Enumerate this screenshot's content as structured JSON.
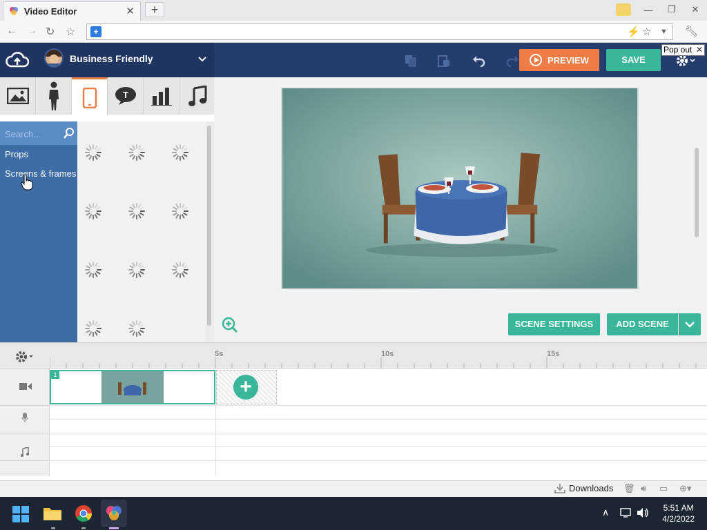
{
  "browser": {
    "tab_title": "Video Editor",
    "tab_close": "✕",
    "new_tab": "+",
    "url": ""
  },
  "header": {
    "theme_name": "Business Friendly",
    "preview_label": "PREVIEW",
    "save_label": "SAVE",
    "popout_label": "Pop out",
    "popout_close": "✕"
  },
  "library": {
    "search_placeholder": "Search...",
    "categories": [
      {
        "label": "Props"
      },
      {
        "label": "Screens & frames"
      }
    ],
    "selected_tab": "phone"
  },
  "stage": {
    "scene_settings_label": "SCENE SETTINGS",
    "add_scene_label": "ADD SCENE"
  },
  "timeline": {
    "ticks": [
      "5s",
      "10s",
      "15s"
    ],
    "scene_number": "1"
  },
  "downloads": {
    "label": "Downloads"
  },
  "taskbar": {
    "time": "5:51 AM",
    "date": "4/2/2022"
  },
  "colors": {
    "accent_orange": "#ef7b45",
    "accent_green": "#3ab79a",
    "header_navy": "#253d6c",
    "sidebar_blue": "#3d6ca6"
  }
}
